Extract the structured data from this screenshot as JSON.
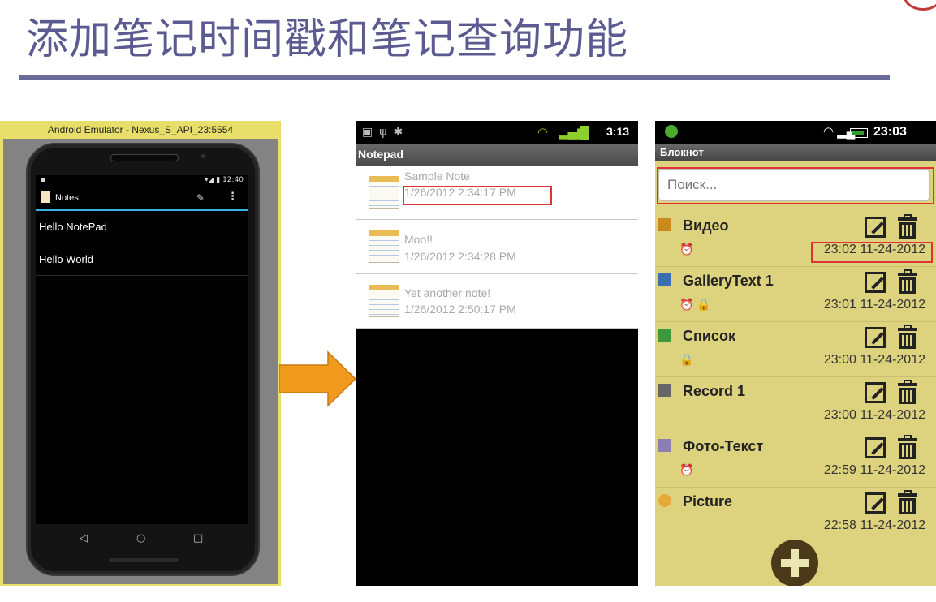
{
  "slide": {
    "title": "添加笔记时间戳和笔记查询功能"
  },
  "panel1": {
    "window_title": "Android Emulator - Nexus_S_API_23:5554",
    "status_time": "12:40",
    "app_title": "Notes",
    "notes": [
      "Hello NotePad",
      "Hello World"
    ],
    "nav": {
      "back": "◁",
      "home": "○",
      "recents": "□"
    }
  },
  "panel2": {
    "status_time": "3:13",
    "app_title": "Notepad",
    "notes": [
      {
        "title": "Sample Note",
        "date": "1/26/2012 2:34:17 PM"
      },
      {
        "title": "Moo!!",
        "date": "1/26/2012 2:34:28 PM"
      },
      {
        "title": "Yet another note!",
        "date": "1/26/2012 2:50:17 PM"
      }
    ]
  },
  "panel3": {
    "status_time": "23:03",
    "app_title": "Блокнот",
    "search_placeholder": "Поиск...",
    "items": [
      {
        "title": "Видео",
        "badges": "⏰",
        "datetime": "23:02 11-24-2012",
        "icon": "film-icon",
        "icon_color": "#c98a1a"
      },
      {
        "title": "GalleryText 1",
        "badges": "⏰ 🔒",
        "datetime": "23:01 11-24-2012",
        "icon": "gallery-icon",
        "icon_color": "#3a6fb0"
      },
      {
        "title": "Список",
        "badges": "🔒",
        "datetime": "23:00 11-24-2012",
        "icon": "cart-icon",
        "icon_color": "#3c9a3c"
      },
      {
        "title": "Record 1",
        "badges": "",
        "datetime": "23:00 11-24-2012",
        "icon": "microphone-icon",
        "icon_color": "#666666"
      },
      {
        "title": "Фото-Текст",
        "badges": "⏰",
        "datetime": "22:59 11-24-2012",
        "icon": "photo-text-icon",
        "icon_color": "#8a7fb0"
      },
      {
        "title": "Picture",
        "badges": "",
        "datetime": "22:58 11-24-2012",
        "icon": "camera-icon",
        "icon_color": "#e6a93a"
      }
    ]
  },
  "colors": {
    "title": "#5b5b92",
    "highlight": "#e03434",
    "arrow": "#f29a1e",
    "note_panel": "#ddd27e"
  }
}
